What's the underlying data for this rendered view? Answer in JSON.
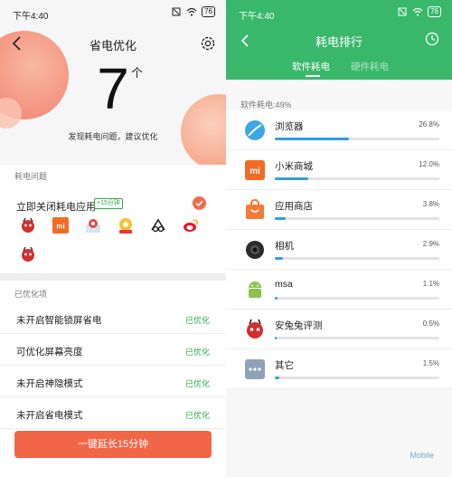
{
  "left": {
    "status_time": "下午4:40",
    "battery": "76",
    "title": "省电优化",
    "score": "7",
    "score_unit": "个",
    "subtitle": "发现耗电问题，建议优化",
    "problems_label": "耗电问题",
    "close_apps_label": "立即关闭耗电应用",
    "close_apps_tag": "+15分钟",
    "apps": [
      {
        "icon": "antutu-app-icon"
      },
      {
        "icon": "mi-app-icon"
      },
      {
        "icon": "maps-app-icon"
      },
      {
        "icon": "chrome-app-icon"
      },
      {
        "icon": "alipay-app-icon"
      },
      {
        "icon": "weibo-app-icon"
      },
      {
        "icon": "antutu-app-icon-2"
      }
    ],
    "optimized_label": "已优化项",
    "optimized_rows": [
      {
        "label": "未开启智能锁屏省电",
        "status": "已优化"
      },
      {
        "label": "可优化屏幕亮度",
        "status": "已优化"
      },
      {
        "label": "未开启神隐模式",
        "status": "已优化"
      },
      {
        "label": "未开启省电模式",
        "status": "已优化"
      }
    ],
    "button_label": "一键延长15分钟",
    "accent": "#f26648",
    "ok_color": "#2da94f"
  },
  "right": {
    "status_time": "下午4:40",
    "battery": "76",
    "title": "耗电排行",
    "tabs": [
      "软件耗电",
      "硬件耗电"
    ],
    "section_label": "软件耗电:49%",
    "header_color": "#39b86c",
    "bar_color": "#2f9fe0",
    "apps": [
      {
        "name": "浏览器",
        "percent": "26.8%",
        "value": 26.8,
        "icon": "browser-icon"
      },
      {
        "name": "小米商城",
        "percent": "12.0%",
        "value": 12.0,
        "icon": "mi-store-icon"
      },
      {
        "name": "应用商店",
        "percent": "3.8%",
        "value": 3.8,
        "icon": "app-store-icon"
      },
      {
        "name": "相机",
        "percent": "2.9%",
        "value": 2.9,
        "icon": "camera-icon"
      },
      {
        "name": "msa",
        "percent": "1.1%",
        "value": 1.1,
        "icon": "android-icon"
      },
      {
        "name": "安兔兔评测",
        "percent": "0.5%",
        "value": 0.5,
        "icon": "antutu-icon"
      },
      {
        "name": "其它",
        "percent": "1.5%",
        "value": 1.5,
        "icon": "more-icon"
      }
    ],
    "watermark": "Mobile"
  }
}
